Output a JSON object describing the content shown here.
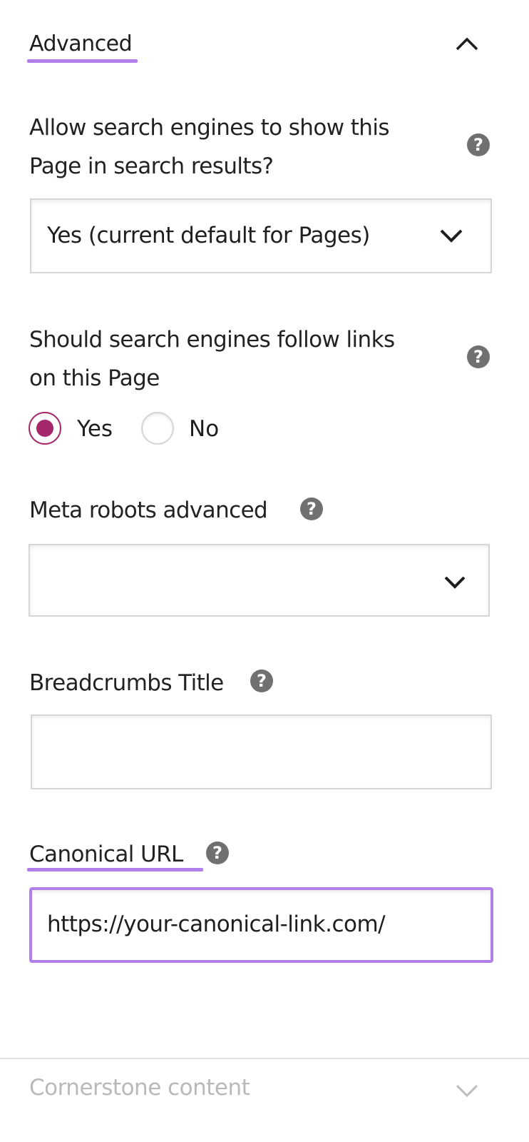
{
  "advanced_section": {
    "title": "Advanced",
    "toggle_icon": "chevron-up-icon",
    "accent_color": "#b07fe9"
  },
  "fields": {
    "show_in_search": {
      "label_line1": "Allow search engines to show this",
      "label_line2": "Page in search results?",
      "help_icon": "question-circle-icon",
      "selected": "Yes (current default for Pages)",
      "dropdown_icon": "chevron-down-icon"
    },
    "follow_links": {
      "label_line1": "Should search engines follow links",
      "label_line2": "on this Page",
      "help_icon": "question-circle-icon",
      "options": [
        {
          "label": "Yes",
          "checked": true
        },
        {
          "label": "No",
          "checked": false
        }
      ],
      "checked_color": "#a4286a"
    },
    "meta_robots": {
      "label": "Meta robots advanced",
      "help_icon": "question-circle-icon",
      "selected": "",
      "dropdown_icon": "chevron-down-icon"
    },
    "breadcrumbs_title": {
      "label": "Breadcrumbs Title",
      "help_icon": "question-circle-icon",
      "value": ""
    },
    "canonical_url": {
      "label": "Canonical URL",
      "help_icon": "question-circle-icon",
      "value": "https://your-canonical-link.com/"
    }
  },
  "cornerstone_section": {
    "title": "Cornerstone content",
    "toggle_icon": "chevron-down-icon"
  }
}
